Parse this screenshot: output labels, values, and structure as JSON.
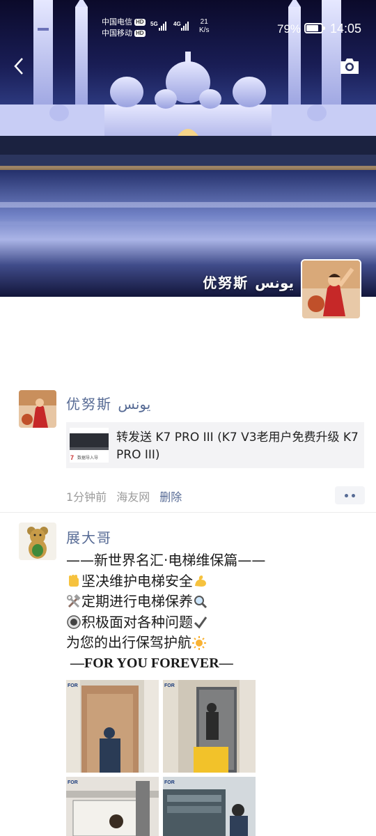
{
  "status_bar": {
    "carrier_1": "中国电信",
    "carrier_2": "中国移动",
    "hd": "HD",
    "signal_1": "5G",
    "signal_2": "4G",
    "net_speed_value": "21",
    "net_speed_unit": "K/s",
    "battery_percent": "79%",
    "battery_level": 0.79,
    "time": "14:05"
  },
  "cover": {
    "user_name": "优努斯 يونس"
  },
  "posts": [
    {
      "author": "优努斯 يونس",
      "share_title": "转发送 K7 PRO III (K7 V3老用户免费升级 K7 PRO III)",
      "share_thumb_caption": "数据导入导",
      "time_ago": "1分钟前",
      "source": "海友网",
      "delete_label": "删除"
    },
    {
      "author": "展大哥",
      "lines": [
        "——新世界名汇·电梯维保篇——",
        "坚决维护电梯安全",
        "定期进行电梯保养",
        "积极面对各种问题",
        "为您的出行保驾护航",
        "—FOR YOU FOREVER—"
      ],
      "photo_watermark": "FOR",
      "emoji": {
        "line_2_lead": "raised-fist-icon",
        "line_2_tail": "flexed-biceps-icon",
        "line_3_lead": "hammer-wrench-icon",
        "line_3_tail": "magnifier-icon",
        "line_4_lead": "radio-button-icon",
        "line_4_tail": "check-mark-icon",
        "line_5_tail": "sun-icon"
      }
    }
  ],
  "colors": {
    "link_blue": "#576b95",
    "meta_gray": "#9b9b9b",
    "card_bg": "#f3f3f5"
  }
}
